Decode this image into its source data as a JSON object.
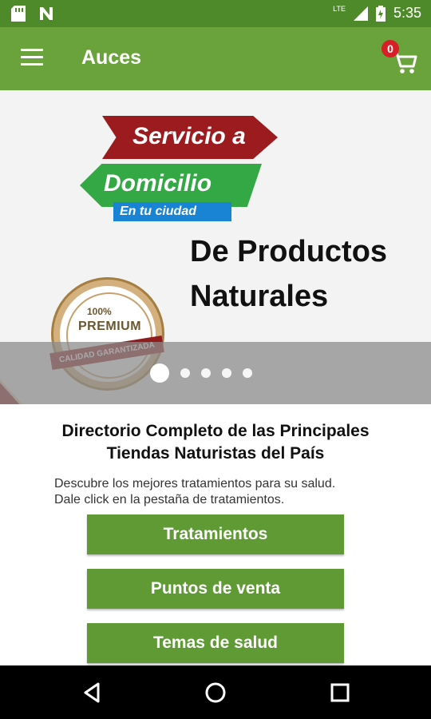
{
  "status_bar": {
    "time": "5:35",
    "network_label": "LTE"
  },
  "app_bar": {
    "title": "Auces",
    "cart_count": "0"
  },
  "banner": {
    "promo_line1": "Servicio a",
    "promo_line2": "Domicilio",
    "promo_tag": "En tu ciudad",
    "headline_line1": "De Productos",
    "headline_line2": "Naturales",
    "seal_top": "100%",
    "seal_main": "PREMIUM",
    "seal_band": "CALIDAD GARANTIZADA",
    "carousel_total": 5,
    "carousel_active": 1
  },
  "content": {
    "heading_line1": "Directorio Completo de las Principales",
    "heading_line2": "Tiendas Naturistas del País",
    "description_line1": "Descubre los mejores tratamientos para su salud.",
    "description_line2": "Dale click en la pestaña de tratamientos.",
    "buttons": [
      {
        "label": "Tratamientos"
      },
      {
        "label": "Puntos de venta"
      },
      {
        "label": "Temas de salud"
      }
    ]
  },
  "colors": {
    "status_bar": "#4f8a2a",
    "app_bar": "#6aa33c",
    "button": "#5f9a35",
    "badge": "#d61f26"
  }
}
